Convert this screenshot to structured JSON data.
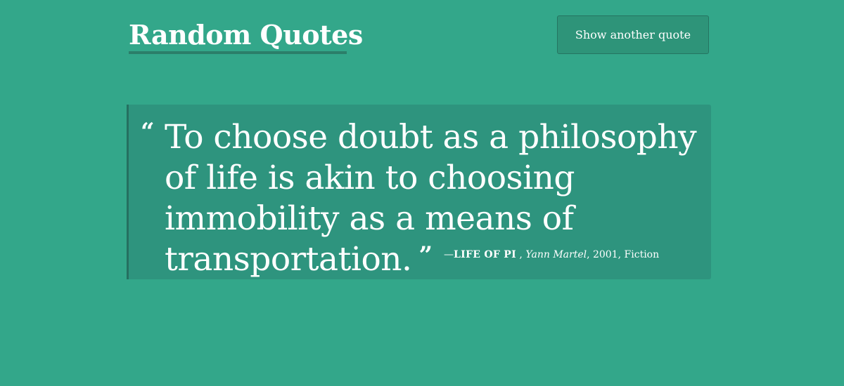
{
  "header": {
    "title": "Random Quotes",
    "button_label": "Show another quote"
  },
  "quote": {
    "open_mark": "“",
    "text": "To choose doubt as a philosophy of life is akin to choosing immobility as a means of transportation.",
    "close_mark": "”",
    "dash": "—",
    "source": "LIFE OF PI",
    "separator_1": " , ",
    "author": "Yann Martel",
    "separator_2": ", ",
    "year": "2001",
    "separator_3": ", ",
    "tag": "Fiction"
  },
  "colors": {
    "background": "#33a78a",
    "panel": "#2e947e",
    "accent_border": "#257060",
    "text": "#ffffff"
  }
}
